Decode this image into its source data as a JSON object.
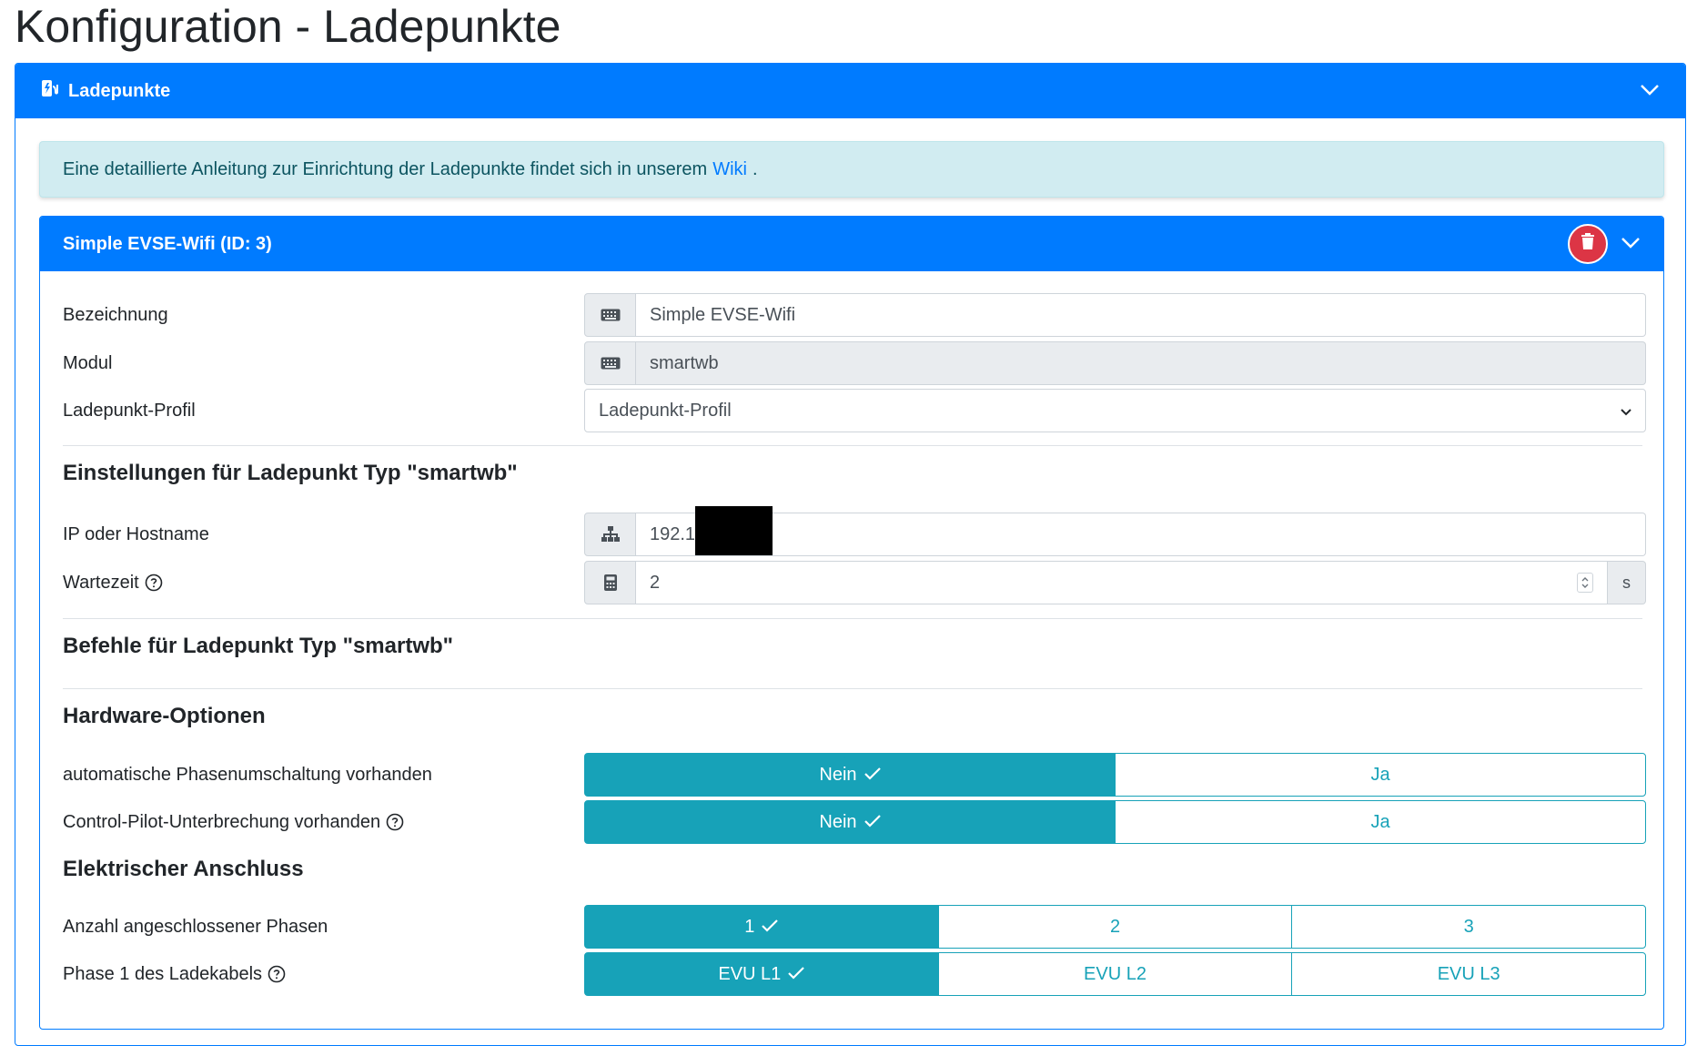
{
  "page": {
    "title": "Konfiguration - Ladepunkte"
  },
  "colors": {
    "primary": "#007bff",
    "info": "#17a2b8",
    "danger": "#dc3545",
    "alert_bg": "#d1ecf1"
  },
  "outer_card": {
    "title": "Ladepunkte",
    "icon": "charging-station-icon",
    "toggle_icon": "chevron-down-icon"
  },
  "alert": {
    "text_before": "Eine detaillierte Anleitung zur Einrichtung der Ladepunkte findet sich in unserem",
    "link": "Wiki",
    "text_after": "."
  },
  "charge_point": {
    "title": "Simple EVSE-Wifi (ID: 3)",
    "delete_icon": "trash-icon",
    "toggle_icon": "chevron-down-icon",
    "fields": {
      "name_label": "Bezeichnung",
      "name_value": "Simple EVSE-Wifi",
      "module_label": "Modul",
      "module_value": "smartwb",
      "profile_label": "Ladepunkt-Profil",
      "profile_value": "Ladepunkt-Profil"
    },
    "settings": {
      "heading": "Einstellungen für Ladepunkt Typ \"smartwb\"",
      "ip_label": "IP oder Hostname",
      "ip_value": "192.1",
      "wait_label": "Wartezeit",
      "wait_value": "2",
      "wait_unit": "s"
    },
    "commands": {
      "heading": "Befehle für Ladepunkt Typ \"smartwb\""
    },
    "hardware": {
      "heading": "Hardware-Optionen",
      "phase_switch_label": "automatische Phasenumschaltung vorhanden",
      "phase_switch_options": [
        "Nein",
        "Ja"
      ],
      "phase_switch_selected": "Nein",
      "cp_label": "Control-Pilot-Unterbrechung vorhanden",
      "cp_options": [
        "Nein",
        "Ja"
      ],
      "cp_selected": "Nein"
    },
    "electrical": {
      "heading": "Elektrischer Anschluss",
      "phases_label": "Anzahl angeschlossener Phasen",
      "phases_options": [
        "1",
        "2",
        "3"
      ],
      "phases_selected": "1",
      "phase1_label": "Phase 1 des Ladekabels",
      "phase1_options": [
        "EVU L1",
        "EVU L2",
        "EVU L3"
      ],
      "phase1_selected": "EVU L1"
    }
  }
}
